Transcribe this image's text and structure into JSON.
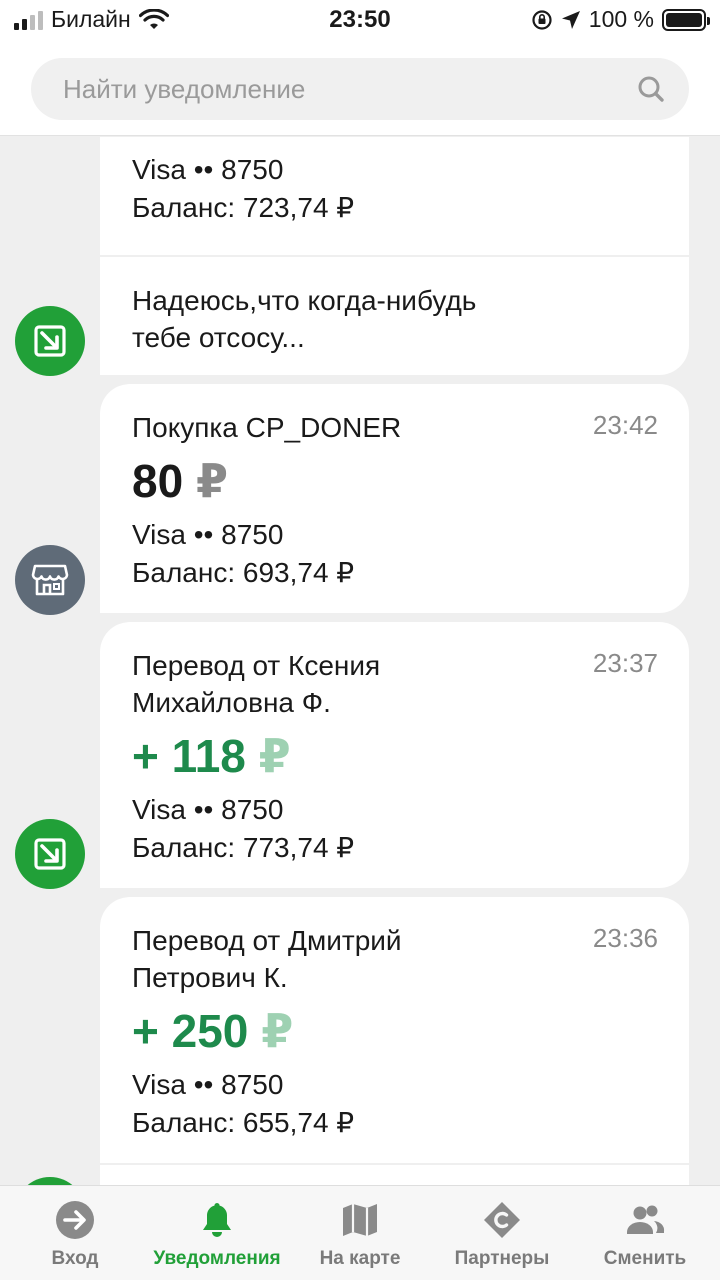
{
  "status_bar": {
    "carrier": "Билайн",
    "time": "23:50",
    "battery": "100 %"
  },
  "search": {
    "placeholder": "Найти уведомление"
  },
  "feed": {
    "partial_card": {
      "card": "Visa •• 8750",
      "balance": "Баланс: 723,74 ₽"
    },
    "message_card": {
      "text_line1": "Надеюсь,что когда-нибудь",
      "text_line2": "тебе отсосу..."
    },
    "purchase": {
      "title": "Покупка CP_DONER",
      "time": "23:42",
      "amount": "80",
      "currency": "₽",
      "card": "Visa •• 8750",
      "balance": "Баланс: 693,74 ₽"
    },
    "transfer1": {
      "title_line1": "Перевод от Ксения",
      "title_line2": "Михайловна Ф.",
      "time": "23:37",
      "amount": "+ 118",
      "currency": "₽",
      "card": "Visa •• 8750",
      "balance": "Баланс: 773,74 ₽"
    },
    "transfer2": {
      "title_line1": "Перевод от Дмитрий",
      "title_line2": "Петрович К.",
      "time": "23:36",
      "amount": "+ 250",
      "currency": "₽",
      "card": "Visa •• 8750",
      "balance": "Баланс: 655,74 ₽"
    }
  },
  "tabs": [
    {
      "label": "Вход",
      "icon": "login-arrow-icon",
      "active": false
    },
    {
      "label": "Уведомления",
      "icon": "bell-icon",
      "active": true
    },
    {
      "label": "На карте",
      "icon": "map-icon",
      "active": false
    },
    {
      "label": "Партнеры",
      "icon": "partners-icon",
      "active": false
    },
    {
      "label": "Сменить",
      "icon": "users-icon",
      "active": false
    }
  ],
  "colors": {
    "accent": "#21a038",
    "income": "#1e8a4c",
    "merchant_avatar": "#5f6b78"
  }
}
